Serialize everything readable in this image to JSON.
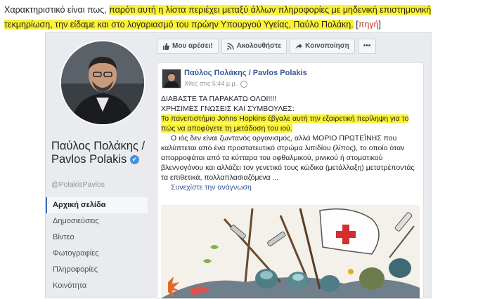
{
  "intro": {
    "plain": "Χαρακτηριστικό είναι πως, ",
    "highlighted": "παρότι αυτή η λίστα περιέχει μεταξύ άλλων πληροφορίες με μηδενική επιστημονική τεκμηρίωση, την είδαμε και στο λογαριασμό του πρώην Υπουργού Υγείας, Παύλο Πολάκη.",
    "source_open": " [",
    "source_link": "πηγή",
    "source_close": "]"
  },
  "profile": {
    "name": "Παύλος Πολάκης / Pavlos Polakis",
    "verified_icon": "check-badge-icon",
    "handle": "@PolakisPavlos"
  },
  "nav": {
    "items": [
      {
        "label": "Αρχική σελίδα",
        "active": true
      },
      {
        "label": "Δημοσιεύσεις"
      },
      {
        "label": "Βίντεο"
      },
      {
        "label": "Φωτογραφίες"
      },
      {
        "label": "Πληροφορίες"
      },
      {
        "label": "Κοινότητα"
      }
    ]
  },
  "buttons": {
    "like": {
      "label": "Μου αρέσει!",
      "icon": "thumbs-up-icon"
    },
    "follow": {
      "label": "Ακολουθήστε",
      "icon": "rss-icon"
    },
    "share": {
      "label": "Κοινοποίηση",
      "icon": "share-arrow-icon"
    },
    "more": {
      "label": "•••",
      "icon": "more-dots-icon"
    }
  },
  "post": {
    "author": "Παύλος Πολάκης / Pavlos Polakis",
    "time": "Χθες στις 5:44 μ.μ.",
    "globe_icon": "globe-icon",
    "line1": "ΔΙΑΒΑΣΤΕ ΤΑ ΠΑΡΑΚΑΤΩ ΟΛΟΙ!!!!",
    "line2": "ΧΡΗΣΙΜΕΣ ΓΝΩΣΕΙΣ ΚΑΙ ΣΥΜΒΟΥΛΕΣ:",
    "highlighted": "Το πανεπιστήμιο Johns Hopkins έβγαλε αυτή την εξαιρετική περίληψη για το πώς να αποφύγετε τη μετάδοση του ιού.",
    "paragraph": "Ο ιός δεν είναι ζωντανός οργανισμός, αλλά ΜΟΡΙΟ ΠΡΩΤΕΪΝΗΣ που καλύπτεται από ένα προστατευτικό στρώμα λιπιδίου (λίπος), το οποίο όταν απορροφάται από τα κύτταρα του οφθαλμικού, ρινικού ή στοματικού βλεννογόνου και αλλάζει τον γενετικό τους κώδικα (μετάλλαξη) μετατρέποντάς τα επιθετικά, πολλαπλασιαζόμενα ...",
    "see_more": "Συνεχίστε την ανάγνωση",
    "image_icon": "medical-battle-cartoon-illustration"
  }
}
